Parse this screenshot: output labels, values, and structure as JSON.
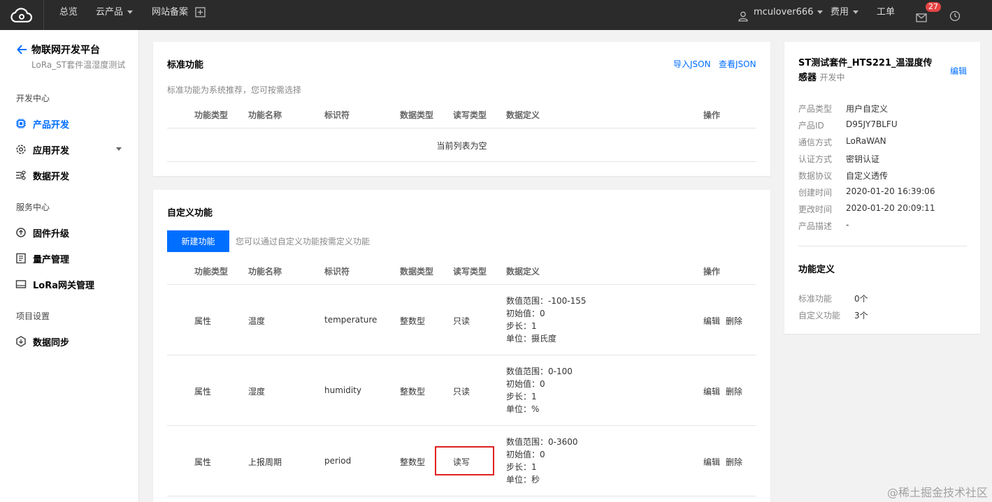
{
  "topbar": {
    "overview": "总览",
    "products": "云产品",
    "filing": "网站备案",
    "user": "mculover666",
    "billing": "费用",
    "ticket": "工单",
    "mail_badge": "27"
  },
  "sidebar": {
    "back_title": "物联网开发平台",
    "subtitle": "LoRa_ST套件温湿度测试",
    "group_dev": "开发中心",
    "group_service": "服务中心",
    "group_project": "项目设置",
    "items": [
      {
        "label": "产品开发"
      },
      {
        "label": "应用开发"
      },
      {
        "label": "数据开发"
      },
      {
        "label": "固件升级"
      },
      {
        "label": "量产管理"
      },
      {
        "label": "LoRa网关管理"
      },
      {
        "label": "数据同步"
      }
    ]
  },
  "standard": {
    "title": "标准功能",
    "import_json": "导入JSON",
    "view_json": "查看JSON",
    "desc": "标准功能为系统推荐，您可按需选择",
    "empty": "当前列表为空"
  },
  "columns": {
    "type": "功能类型",
    "name": "功能名称",
    "id": "标识符",
    "dtype": "数据类型",
    "rw": "读写类型",
    "def": "数据定义",
    "op": "操作"
  },
  "custom": {
    "title": "自定义功能",
    "new_button": "新建功能",
    "hint": "您可以通过自定义功能按需定义功能",
    "edit": "编辑",
    "delete": "删除",
    "rows": [
      {
        "type": "属性",
        "name": "温度",
        "id": "temperature",
        "dtype": "整数型",
        "rw": "只读",
        "def": [
          "数值范围：-100-155",
          "初始值：0",
          "步长：1",
          "单位：摄氏度"
        ]
      },
      {
        "type": "属性",
        "name": "湿度",
        "id": "humidity",
        "dtype": "整数型",
        "rw": "只读",
        "def": [
          "数值范围：0-100",
          "初始值：0",
          "步长：1",
          "单位：%"
        ]
      },
      {
        "type": "属性",
        "name": "上报周期",
        "id": "period",
        "dtype": "整数型",
        "rw": "读写",
        "def": [
          "数值范围：0-3600",
          "初始值：0",
          "步长：1",
          "单位：秒"
        ]
      }
    ]
  },
  "product": {
    "title_line1": "ST测试套件_HTS221_温湿度传",
    "title_line2": "感器",
    "status": "开发中",
    "edit": "编辑",
    "fields": [
      {
        "label": "产品类型",
        "value": "用户自定义"
      },
      {
        "label": "产品ID",
        "value": "D95JY7BLFU"
      },
      {
        "label": "通信方式",
        "value": "LoRaWAN"
      },
      {
        "label": "认证方式",
        "value": "密钥认证"
      },
      {
        "label": "数据协议",
        "value": "自定义透传"
      },
      {
        "label": "创建时间",
        "value": "2020-01-20 16:39:06"
      },
      {
        "label": "更改时间",
        "value": "2020-01-20 20:09:11"
      },
      {
        "label": "产品描述",
        "value": "-"
      }
    ],
    "func_title": "功能定义",
    "func_fields": [
      {
        "label": "标准功能",
        "value": "0个"
      },
      {
        "label": "自定义功能",
        "value": "3个"
      }
    ]
  },
  "watermark": "@稀土掘金技术社区",
  "colors": {
    "accent": "#006eff",
    "topbar": "#2b2b2b",
    "badge": "#e54545",
    "highlight": "#e02020"
  }
}
